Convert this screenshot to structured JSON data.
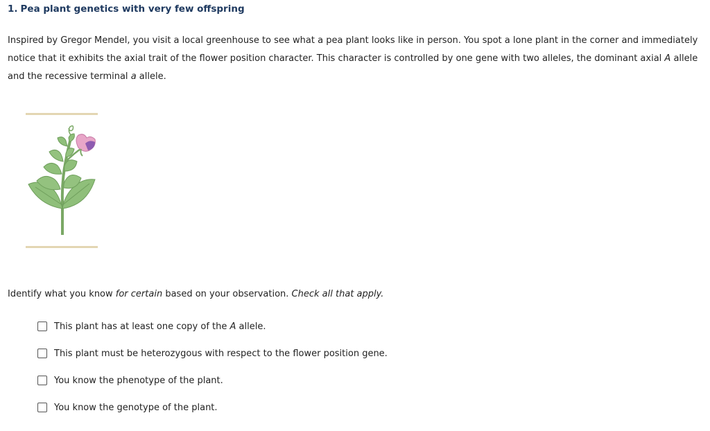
{
  "question": {
    "number": "1.",
    "title": "Pea plant genetics with very few offspring"
  },
  "intro": {
    "part1": "Inspired by Gregor Mendel, you visit a local greenhouse to see what a pea plant looks like in person. You spot a lone plant in the corner and immediately notice that it exhibits the axial trait of the flower position character. This character is controlled by one gene with two alleles, the dominant axial ",
    "allele_dominant": "A",
    "part2": " allele and the recessive terminal ",
    "allele_recessive": "a",
    "part3": " allele."
  },
  "figure": {
    "icon": "pea-plant-illustration",
    "colors": {
      "leaf": "#8fbf7a",
      "leaf_dark": "#6f9f5c",
      "stem": "#7aa865",
      "flower_pink": "#e8a6c8",
      "flower_purple": "#8e5bb0",
      "bar": "#e3d6b3"
    }
  },
  "prompt": {
    "part1": "Identify what you know ",
    "emph1": "for certain",
    "part2": " based on your observation. ",
    "emph2": "Check all that apply."
  },
  "options": [
    {
      "pre": "This plant has at least one copy of the ",
      "emph": "A",
      "post": " allele."
    },
    {
      "pre": "This plant must be heterozygous with respect to the flower position gene.",
      "emph": "",
      "post": ""
    },
    {
      "pre": "You know the phenotype of the plant.",
      "emph": "",
      "post": ""
    },
    {
      "pre": "You know the genotype of the plant.",
      "emph": "",
      "post": ""
    }
  ]
}
